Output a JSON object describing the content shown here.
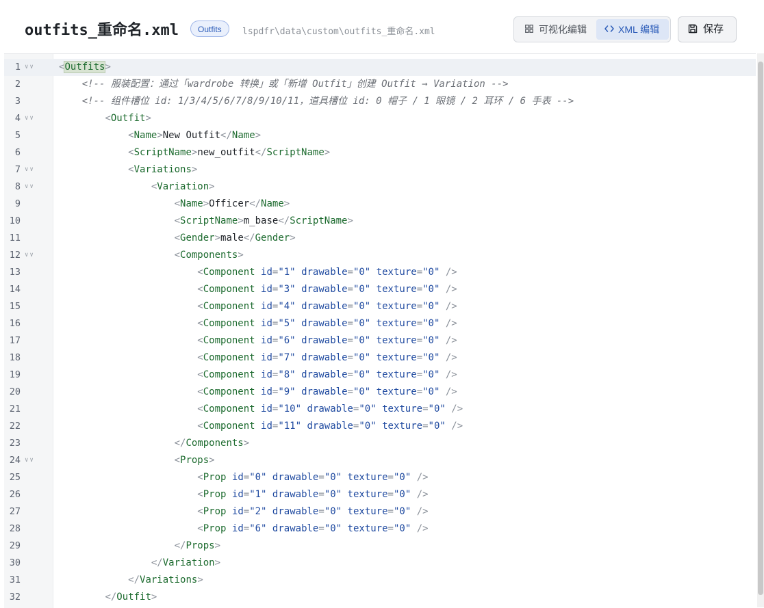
{
  "header": {
    "file_name": "outfits_重命名.xml",
    "badge": "Outfits",
    "file_path": "lspdfr\\data\\custom\\outfits_重命名.xml",
    "visual_edit_label": "可视化编辑",
    "xml_edit_label": "XML 编辑",
    "save_label": "保存",
    "active_mode": "XML 编辑"
  },
  "icons": {
    "visual_edit": "grid-icon",
    "xml_edit": "code-icon",
    "save": "floppy-disk-icon",
    "fold": "chevron-down-icon"
  },
  "colors": {
    "accent": "#2b5bb8",
    "tag": "#1d6b2f",
    "attr": "#1f4aa0",
    "comment": "#6b6f76"
  },
  "editor": {
    "active_line": 1,
    "lines": [
      {
        "n": "1",
        "fold": true,
        "code": "<Outfits>"
      },
      {
        "n": "2",
        "fold": false,
        "code": "    <!-- 服装配置：通过「wardrobe 转换」或「新增 Outfit」创建 Outfit → Variation -->"
      },
      {
        "n": "3",
        "fold": false,
        "code": "    <!-- 组件槽位 id: 1/3/4/5/6/7/8/9/10/11，道具槽位 id: 0 帽子 / 1 眼镜 / 2 耳环 / 6 手表 -->"
      },
      {
        "n": "4",
        "fold": true,
        "code": "        <Outfit>"
      },
      {
        "n": "5",
        "fold": false,
        "code": "            <Name>New Outfit</Name>"
      },
      {
        "n": "6",
        "fold": false,
        "code": "            <ScriptName>new_outfit</ScriptName>"
      },
      {
        "n": "7",
        "fold": true,
        "code": "            <Variations>"
      },
      {
        "n": "8",
        "fold": true,
        "code": "                <Variation>"
      },
      {
        "n": "9",
        "fold": false,
        "code": "                    <Name>Officer</Name>"
      },
      {
        "n": "10",
        "fold": false,
        "code": "                    <ScriptName>m_base</ScriptName>"
      },
      {
        "n": "11",
        "fold": false,
        "code": "                    <Gender>male</Gender>"
      },
      {
        "n": "12",
        "fold": true,
        "code": "                    <Components>"
      },
      {
        "n": "13",
        "fold": false,
        "code": "                        <Component id=\"1\" drawable=\"0\" texture=\"0\" />"
      },
      {
        "n": "14",
        "fold": false,
        "code": "                        <Component id=\"3\" drawable=\"0\" texture=\"0\" />"
      },
      {
        "n": "15",
        "fold": false,
        "code": "                        <Component id=\"4\" drawable=\"0\" texture=\"0\" />"
      },
      {
        "n": "16",
        "fold": false,
        "code": "                        <Component id=\"5\" drawable=\"0\" texture=\"0\" />"
      },
      {
        "n": "17",
        "fold": false,
        "code": "                        <Component id=\"6\" drawable=\"0\" texture=\"0\" />"
      },
      {
        "n": "18",
        "fold": false,
        "code": "                        <Component id=\"7\" drawable=\"0\" texture=\"0\" />"
      },
      {
        "n": "19",
        "fold": false,
        "code": "                        <Component id=\"8\" drawable=\"0\" texture=\"0\" />"
      },
      {
        "n": "20",
        "fold": false,
        "code": "                        <Component id=\"9\" drawable=\"0\" texture=\"0\" />"
      },
      {
        "n": "21",
        "fold": false,
        "code": "                        <Component id=\"10\" drawable=\"0\" texture=\"0\" />"
      },
      {
        "n": "22",
        "fold": false,
        "code": "                        <Component id=\"11\" drawable=\"0\" texture=\"0\" />"
      },
      {
        "n": "23",
        "fold": false,
        "code": "                    </Components>"
      },
      {
        "n": "24",
        "fold": true,
        "code": "                    <Props>"
      },
      {
        "n": "25",
        "fold": false,
        "code": "                        <Prop id=\"0\" drawable=\"0\" texture=\"0\" />"
      },
      {
        "n": "26",
        "fold": false,
        "code": "                        <Prop id=\"1\" drawable=\"0\" texture=\"0\" />"
      },
      {
        "n": "27",
        "fold": false,
        "code": "                        <Prop id=\"2\" drawable=\"0\" texture=\"0\" />"
      },
      {
        "n": "28",
        "fold": false,
        "code": "                        <Prop id=\"6\" drawable=\"0\" texture=\"0\" />"
      },
      {
        "n": "29",
        "fold": false,
        "code": "                    </Props>"
      },
      {
        "n": "30",
        "fold": false,
        "code": "                </Variation>"
      },
      {
        "n": "31",
        "fold": false,
        "code": "            </Variations>"
      },
      {
        "n": "32",
        "fold": false,
        "code": "        </Outfit>"
      }
    ]
  }
}
